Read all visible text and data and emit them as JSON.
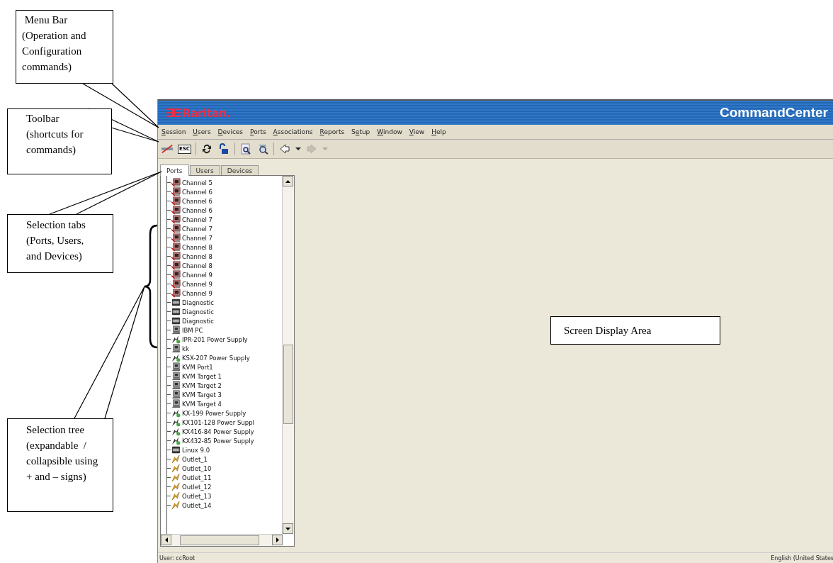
{
  "annotations": [
    {
      "text": " Menu Bar (Operation and Configuration commands)"
    },
    {
      "text": "Toolbar (shortcuts for commands)"
    },
    {
      "text": "Selection tabs (Ports, Users, and Devices)"
    },
    {
      "text": "Selection tree (expandable  / collapsible using + and – signs)"
    },
    {
      "text": "Screen Display Area"
    }
  ],
  "window": {
    "logo": "Raritan.",
    "title": "CommandCenter"
  },
  "menu": [
    {
      "key": "S",
      "after": "ession"
    },
    {
      "key": "U",
      "after": "sers"
    },
    {
      "key": "D",
      "after": "evices"
    },
    {
      "key": "P",
      "after": "orts"
    },
    {
      "key": "A",
      "after": "ssociations"
    },
    {
      "key": "R",
      "after": "eports"
    },
    {
      "before": "S",
      "key": "e",
      "after": "tup"
    },
    {
      "key": "W",
      "after": "indow"
    },
    {
      "key": "V",
      "after": "iew"
    },
    {
      "key": "H",
      "after": "elp"
    }
  ],
  "toolbar": [
    {
      "kind": "disconnect",
      "disabled": false
    },
    {
      "kind": "esc",
      "label": "ESC",
      "disabled": false
    },
    {
      "kind": "separator"
    },
    {
      "kind": "refresh",
      "disabled": false
    },
    {
      "kind": "lock",
      "disabled": false
    },
    {
      "kind": "separator"
    },
    {
      "kind": "find",
      "disabled": false
    },
    {
      "kind": "inspect",
      "disabled": false
    },
    {
      "kind": "separator"
    },
    {
      "kind": "back",
      "disabled": false
    },
    {
      "kind": "caret",
      "disabled": false
    },
    {
      "kind": "forward",
      "disabled": true
    },
    {
      "kind": "caret",
      "disabled": true
    }
  ],
  "tabs": [
    {
      "label": "Ports",
      "selected": true
    },
    {
      "label": "Users",
      "selected": false
    },
    {
      "label": "Devices",
      "selected": false
    }
  ],
  "tree": [
    {
      "label": "Channel 5",
      "kind": "channel"
    },
    {
      "label": "Channel 6",
      "kind": "channel"
    },
    {
      "label": "Channel 6",
      "kind": "channel"
    },
    {
      "label": "Channel 6",
      "kind": "channel"
    },
    {
      "label": "Channel 7",
      "kind": "channel"
    },
    {
      "label": "Channel 7",
      "kind": "channel"
    },
    {
      "label": "Channel 7",
      "kind": "channel"
    },
    {
      "label": "Channel 8",
      "kind": "channel"
    },
    {
      "label": "Channel 8",
      "kind": "channel"
    },
    {
      "label": "Channel 8",
      "kind": "channel"
    },
    {
      "label": "Channel 9",
      "kind": "channel"
    },
    {
      "label": "Channel 9",
      "kind": "channel"
    },
    {
      "label": "Channel 9",
      "kind": "channel"
    },
    {
      "label": "Diagnostic",
      "kind": "serial"
    },
    {
      "label": "Diagnostic",
      "kind": "serial"
    },
    {
      "label": "Diagnostic",
      "kind": "serial"
    },
    {
      "label": "IBM PC",
      "kind": "computer"
    },
    {
      "label": "IPR-201 Power Supply",
      "kind": "power"
    },
    {
      "label": "kk",
      "kind": "computer"
    },
    {
      "label": "KSX-207 Power Supply",
      "kind": "power"
    },
    {
      "label": "KVM Port1",
      "kind": "computer"
    },
    {
      "label": "KVM Target 1",
      "kind": "computer"
    },
    {
      "label": "KVM Target 2",
      "kind": "computer"
    },
    {
      "label": "KVM Target 3",
      "kind": "computer"
    },
    {
      "label": "KVM Target 4",
      "kind": "computer"
    },
    {
      "label": "KX-199 Power Supply",
      "kind": "power"
    },
    {
      "label": "KX101-128 Power Suppl",
      "kind": "power"
    },
    {
      "label": "KX416-84 Power Supply",
      "kind": "power"
    },
    {
      "label": "KX432-85 Power Supply",
      "kind": "power"
    },
    {
      "label": "Linux 9.0",
      "kind": "serial"
    },
    {
      "label": "Outlet_1",
      "kind": "outlet"
    },
    {
      "label": "Outlet_10",
      "kind": "outlet"
    },
    {
      "label": "Outlet_11",
      "kind": "outlet"
    },
    {
      "label": "Outlet_12",
      "kind": "outlet"
    },
    {
      "label": "Outlet_13",
      "kind": "outlet"
    },
    {
      "label": "Outlet_14",
      "kind": "outlet"
    }
  ],
  "status_bar": {
    "user": "User: ccRoot",
    "locale": "English (United States"
  }
}
